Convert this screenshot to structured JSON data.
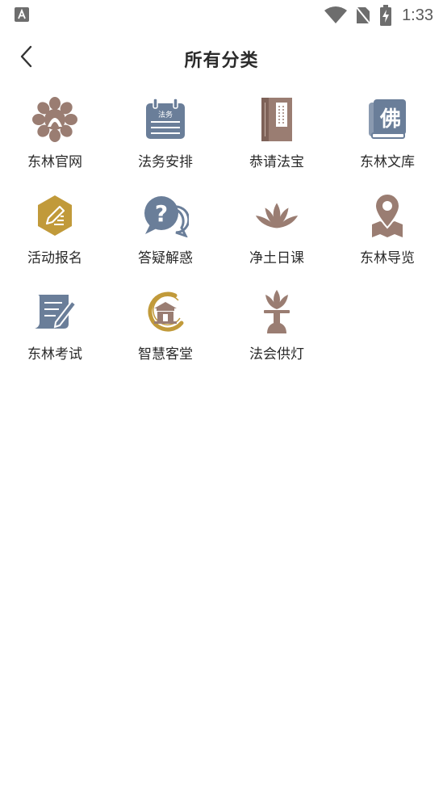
{
  "status_bar": {
    "time": "1:33"
  },
  "header": {
    "title": "所有分类"
  },
  "categories": [
    {
      "label": "东林官网",
      "icon": "lotus-seal-icon"
    },
    {
      "label": "法务安排",
      "icon": "calendar-icon",
      "icon_text": "法务"
    },
    {
      "label": "恭请法宝",
      "icon": "scripture-book-icon"
    },
    {
      "label": "东林文库",
      "icon": "library-book-icon",
      "icon_text": "佛"
    },
    {
      "label": "活动报名",
      "icon": "signup-edit-icon"
    },
    {
      "label": "答疑解惑",
      "icon": "question-bubble-icon",
      "icon_text": "?"
    },
    {
      "label": "净土日课",
      "icon": "lotus-icon"
    },
    {
      "label": "东林导览",
      "icon": "map-pin-icon"
    },
    {
      "label": "东林考试",
      "icon": "exam-paper-icon"
    },
    {
      "label": "智慧客堂",
      "icon": "temple-hall-icon"
    },
    {
      "label": "法会供灯",
      "icon": "offering-lamp-icon"
    }
  ],
  "colors": {
    "brown": "#9a7d72",
    "slate_blue": "#6a7e99",
    "gold": "#c19a3a",
    "text": "#2a2a2a"
  }
}
